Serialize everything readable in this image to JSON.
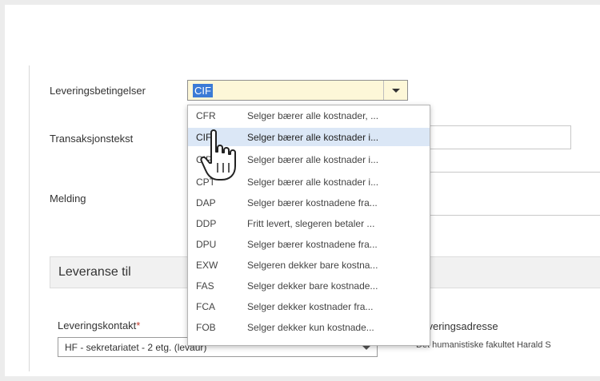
{
  "form": {
    "delivery_terms_label": "Leveringsbetingelser",
    "delivery_terms_value": "CIF",
    "transaction_text_label": "Transaksjonstekst",
    "message_label": "Melding"
  },
  "dropdown": {
    "options": [
      {
        "code": "CFR",
        "desc": "Selger bærer alle kostnader, ..."
      },
      {
        "code": "CIF",
        "desc": "Selger bærer alle kostnader i..."
      },
      {
        "code": "CIP",
        "desc": "Selger bærer alle kostnader i..."
      },
      {
        "code": "CPT",
        "desc": "Selger bærer alle kostnader i..."
      },
      {
        "code": "DAP",
        "desc": "Selger bærer kostnadene fra..."
      },
      {
        "code": "DDP",
        "desc": "Fritt levert, slegeren betaler ..."
      },
      {
        "code": "DPU",
        "desc": "Selger bærer kostnadene fra..."
      },
      {
        "code": "EXW",
        "desc": "Selgeren dekker bare kostna..."
      },
      {
        "code": "FAS",
        "desc": "Selger dekker bare kostnade..."
      },
      {
        "code": "FCA",
        "desc": "Selger dekker kostnader fra..."
      },
      {
        "code": "FOB",
        "desc": "Selger dekker kun kostnade..."
      }
    ],
    "highlighted_index": 1
  },
  "delivery": {
    "section_title": "Leveranse til",
    "contact_label": "Leveringskontakt",
    "required_marker": "*",
    "contact_value": "HF - sekretariatet - 2 etg. (levaur)",
    "address_label": "Leveringsadresse",
    "address_value": "Det humanistiske fakultet Harald S"
  },
  "icons": {
    "cursor": "hand-pointer-icon",
    "dropdown": "chevron-down-icon"
  }
}
